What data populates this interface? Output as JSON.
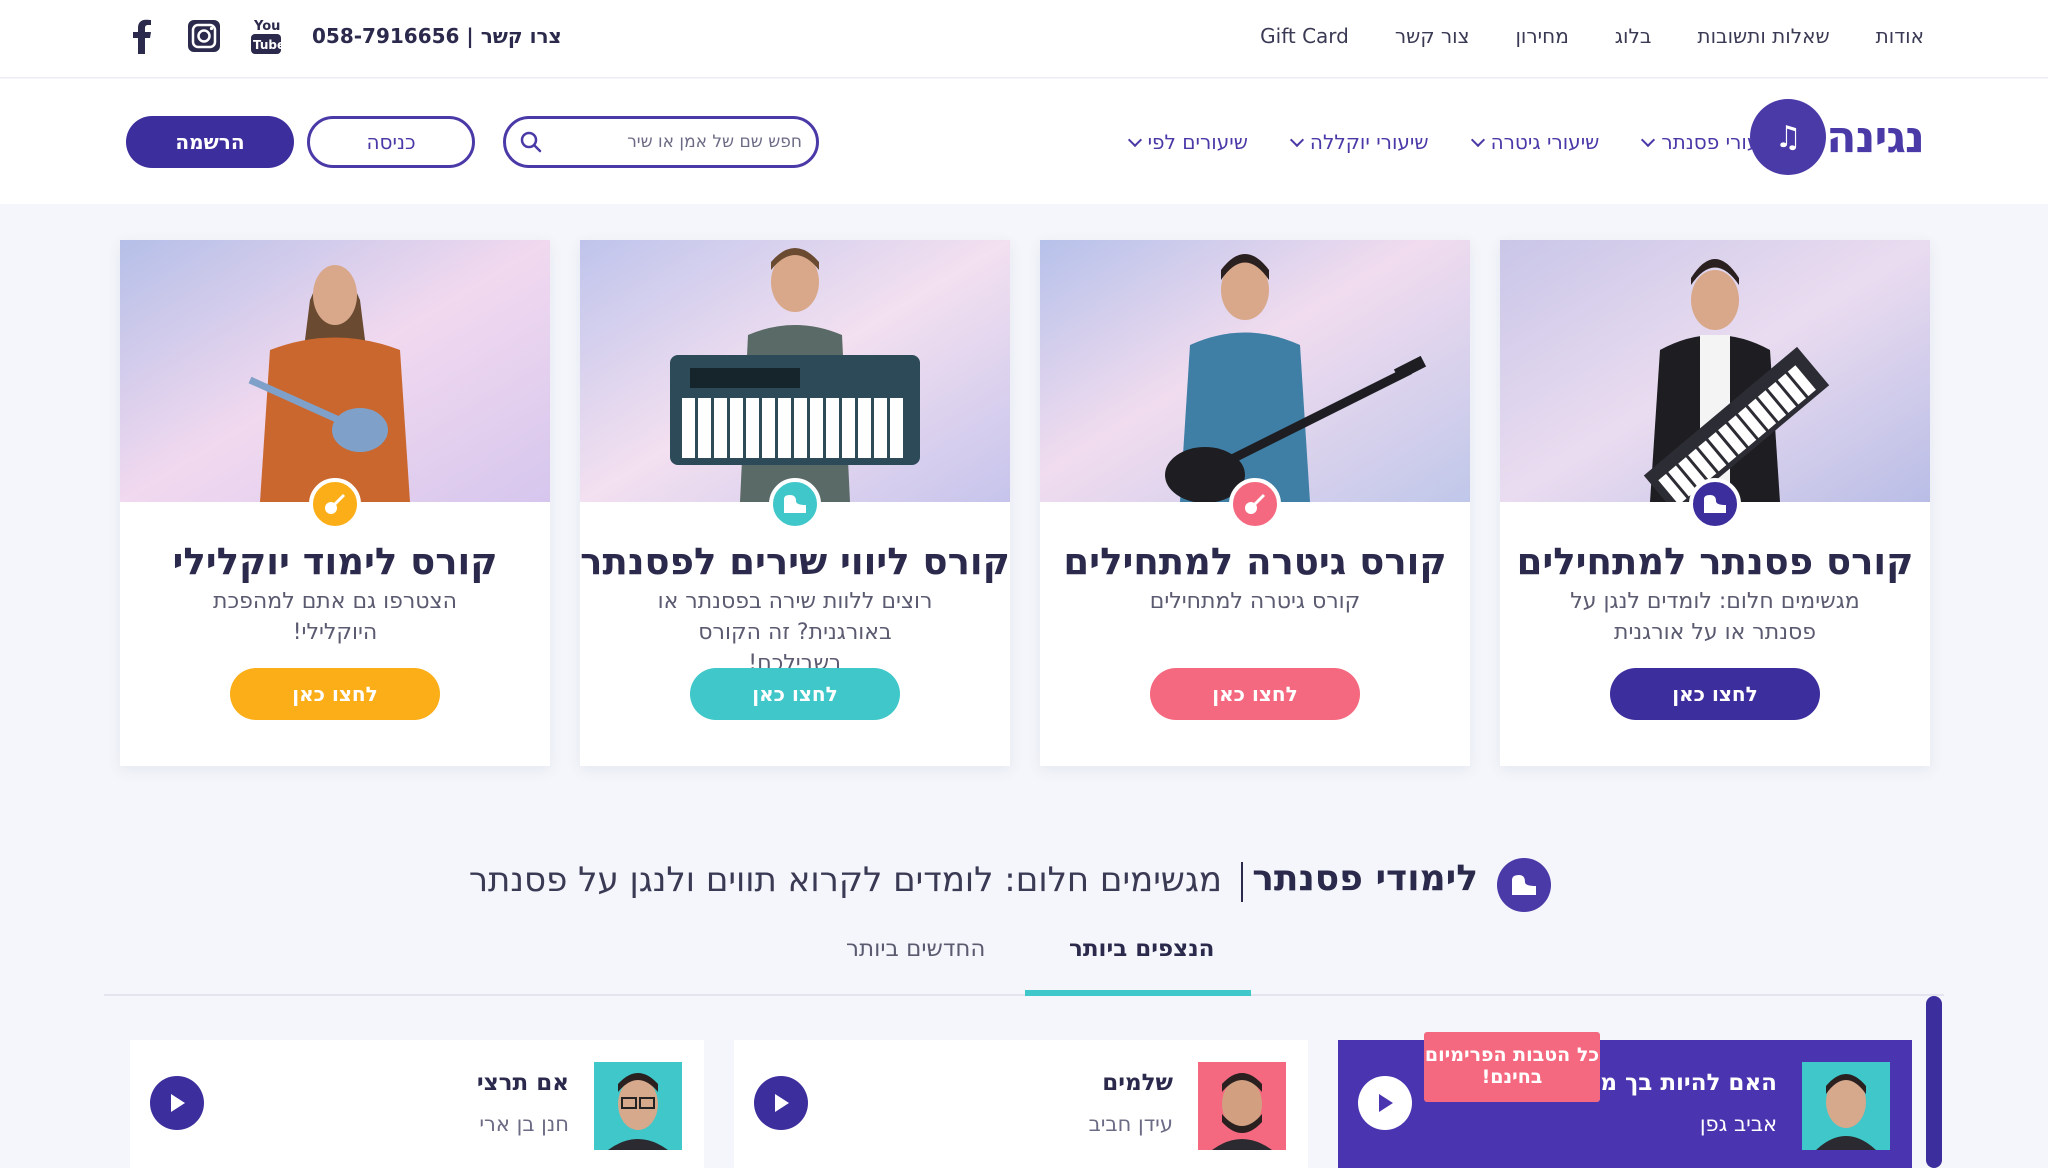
{
  "topbar": {
    "nav": [
      "אודות",
      "שאלות ותשובות",
      "בלוג",
      "מחירון",
      "צור קשר",
      "Gift Card"
    ],
    "contact": "צרו קשר | 058-7916656",
    "social_icons": [
      "facebook-icon",
      "instagram-icon",
      "youtube-icon"
    ]
  },
  "header": {
    "logo": "נגינה",
    "nav": [
      "שיעורי פסנתר",
      "שיעורי גיטרה",
      "שיעורי יוקללה",
      "שיעורים לפי"
    ],
    "search_placeholder": "חפש שם של אמן או שיר",
    "login": "כניסה",
    "signup": "הרשמה"
  },
  "courses": [
    {
      "title": "קורס פסנתר למתחילים",
      "desc": "מגשימים חלום: לומדים לנגן על פסנתר או על אורגנית",
      "cta": "לחצו כאן",
      "color": "#3d2e9e",
      "icon": "piano-icon"
    },
    {
      "title": "קורס גיטרה למתחילים",
      "desc": "קורס גיטרה למתחילים",
      "cta": "לחצו כאן",
      "color": "#f4697f",
      "icon": "guitar-icon"
    },
    {
      "title": "קורס ליווי שירים לפסנתר",
      "desc": "רוצים ללוות שירה בפסנתר או באורגנית? זה הקורס בשבילכם!",
      "cta": "לחצו כאן",
      "color": "#3fc7c9",
      "icon": "piano-icon"
    },
    {
      "title": "קורס לימוד יוקלילי",
      "desc": "הצטרפו גם אתם למהפכת היוקלילי!",
      "cta": "לחצו כאן",
      "color": "#fbae17",
      "icon": "ukulele-icon"
    }
  ],
  "section": {
    "title": "לימודי פסנתר",
    "subtitle": "מגשימים חלום: לומדים לקרוא תווים ולנגן על פסנתר",
    "tabs": [
      "הנצפים ביותר",
      "החדשים ביותר"
    ]
  },
  "songs": [
    {
      "name": "האם להיות בך מא",
      "artist": "אביב גפן"
    },
    {
      "name": "שלמים",
      "artist": "עידן חביב"
    },
    {
      "name": "אם תרצי",
      "artist": "חנן בן ארי"
    }
  ],
  "promo": "כל הטבות הפרימיום בחינם!",
  "colors": {
    "primary": "#3d2e9e",
    "accent_teal": "#3fc7c9",
    "accent_pink": "#f4697f",
    "accent_orange": "#fbae17"
  }
}
